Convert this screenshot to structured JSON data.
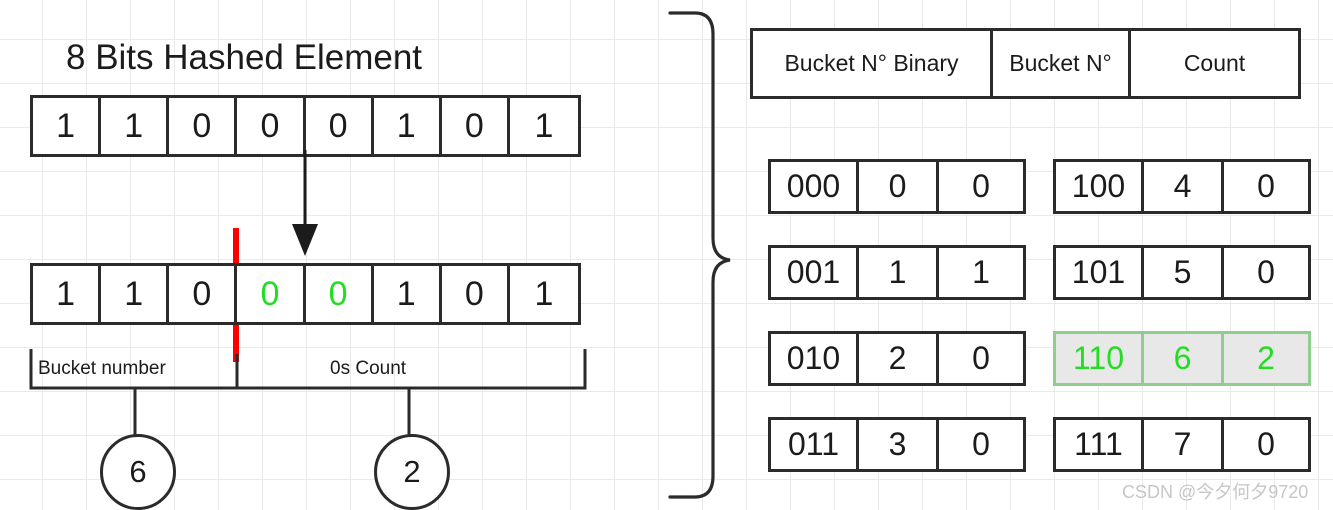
{
  "colors": {
    "ink": "#1b1b1b",
    "border": "#2b2b2b",
    "grid": "#eaeaea",
    "red_marker": "#ff0000",
    "highlight_text": "#22dd22",
    "highlight_fill": "#e8e8e8",
    "highlight_border": "#8fce8f",
    "watermark": "#c6c6c6"
  },
  "left_panel": {
    "title": "8 Bits Hashed Element",
    "hashed_bits_top": [
      "1",
      "1",
      "0",
      "0",
      "0",
      "1",
      "0",
      "1"
    ],
    "hashed_bits_bottom": [
      {
        "value": "1",
        "highlight": false
      },
      {
        "value": "1",
        "highlight": false
      },
      {
        "value": "0",
        "highlight": false
      },
      {
        "value": "0",
        "highlight": true
      },
      {
        "value": "0",
        "highlight": true
      },
      {
        "value": "1",
        "highlight": false
      },
      {
        "value": "0",
        "highlight": false
      },
      {
        "value": "1",
        "highlight": false
      }
    ],
    "brace_labels": {
      "bucket_number": "Bucket number",
      "zeros_count": "0s Count"
    },
    "results": {
      "bucket_number_value": "6",
      "zeros_count_value": "2"
    }
  },
  "right_panel": {
    "header": {
      "col_binary": "Bucket N° Binary",
      "col_number": "Bucket N°",
      "col_count": "Count"
    },
    "buckets_left": [
      {
        "binary": "000",
        "number": "0",
        "count": "0",
        "highlight": false
      },
      {
        "binary": "001",
        "number": "1",
        "count": "1",
        "highlight": false
      },
      {
        "binary": "010",
        "number": "2",
        "count": "0",
        "highlight": false
      },
      {
        "binary": "011",
        "number": "3",
        "count": "0",
        "highlight": false
      }
    ],
    "buckets_right": [
      {
        "binary": "100",
        "number": "4",
        "count": "0",
        "highlight": false
      },
      {
        "binary": "101",
        "number": "5",
        "count": "0",
        "highlight": false
      },
      {
        "binary": "110",
        "number": "6",
        "count": "2",
        "highlight": true
      },
      {
        "binary": "111",
        "number": "7",
        "count": "0",
        "highlight": false
      }
    ]
  },
  "watermark": "CSDN @今夕何夕9720"
}
